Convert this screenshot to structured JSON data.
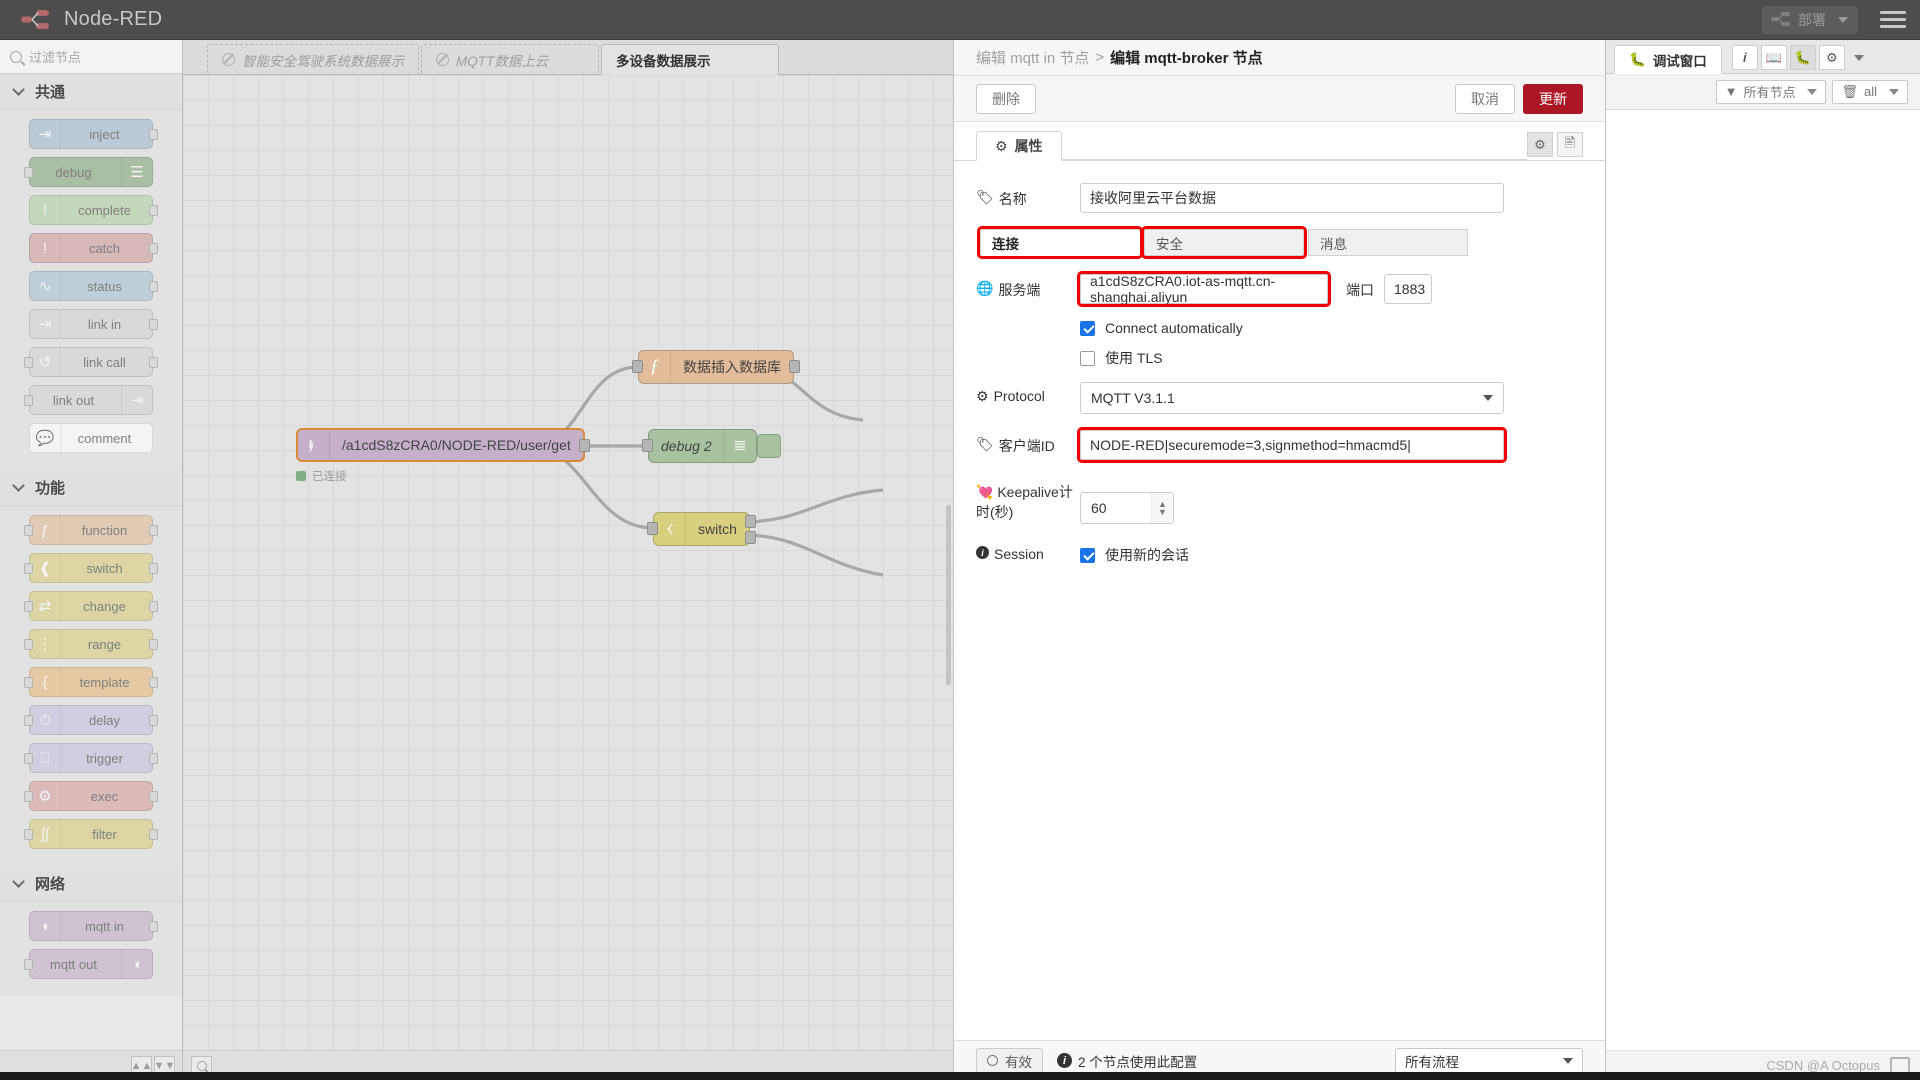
{
  "header": {
    "brand": "Node-RED",
    "logo_icon": "node-red-logo-icon",
    "deploy_label": "部署",
    "deploy_icon": "deploy-icon",
    "menu_icon": "hamburger-menu-icon"
  },
  "palette": {
    "search_placeholder": "过滤节点",
    "search_icon": "search-icon",
    "collapse_icon": "collapse-all-icon",
    "expand_icon": "expand-all-icon",
    "categories": [
      {
        "label": "共通",
        "nodes": [
          {
            "label": "inject",
            "icon": "inject-icon",
            "color": "#a6bbcf",
            "icon_side": "left",
            "ports": "out"
          },
          {
            "label": "debug",
            "icon": "debug-icon",
            "color": "#87a980",
            "icon_side": "right",
            "ports": "in"
          },
          {
            "label": "complete",
            "icon": "complete-icon",
            "color": "#b5d3a5",
            "icon_side": "left",
            "ports": "out"
          },
          {
            "label": "catch",
            "icon": "catch-icon",
            "color": "#d1a0a0",
            "icon_side": "left",
            "ports": "out"
          },
          {
            "label": "status",
            "icon": "status-icon",
            "color": "#a9c5d1",
            "icon_side": "left",
            "ports": "out"
          },
          {
            "label": "link in",
            "icon": "link-in-icon",
            "color": "#d4d4d4",
            "icon_side": "left",
            "ports": "out"
          },
          {
            "label": "link call",
            "icon": "link-call-icon",
            "color": "#d4d4d4",
            "icon_side": "left",
            "ports": "both"
          },
          {
            "label": "link out",
            "icon": "link-out-icon",
            "color": "#d4d4d4",
            "icon_side": "right",
            "ports": "in"
          },
          {
            "label": "comment",
            "icon": "comment-icon",
            "color": "#ffffff",
            "icon_side": "left",
            "ports": "none"
          }
        ]
      },
      {
        "label": "功能",
        "nodes": [
          {
            "label": "function",
            "icon": "function-icon",
            "color": "#e3bd9a",
            "icon_side": "left",
            "ports": "both"
          },
          {
            "label": "switch",
            "icon": "switch-icon",
            "color": "#d8d07f",
            "icon_side": "left",
            "ports": "both"
          },
          {
            "label": "change",
            "icon": "change-icon",
            "color": "#d8d07f",
            "icon_side": "left",
            "ports": "both"
          },
          {
            "label": "range",
            "icon": "range-icon",
            "color": "#d8d07f",
            "icon_side": "left",
            "ports": "both"
          },
          {
            "label": "template",
            "icon": "template-icon",
            "color": "#e8bb7d",
            "icon_side": "left",
            "ports": "both"
          },
          {
            "label": "delay",
            "icon": "delay-icon",
            "color": "#c6c3de",
            "icon_side": "left",
            "ports": "both"
          },
          {
            "label": "trigger",
            "icon": "trigger-icon",
            "color": "#c6c3de",
            "icon_side": "left",
            "ports": "both"
          },
          {
            "label": "exec",
            "icon": "exec-icon",
            "color": "#d7a3a0",
            "icon_side": "left",
            "ports": "both"
          },
          {
            "label": "filter",
            "icon": "filter-icon",
            "color": "#d8d07f",
            "icon_side": "left",
            "ports": "both"
          }
        ]
      },
      {
        "label": "网络",
        "nodes": [
          {
            "label": "mqtt in",
            "icon": "mqtt-icon",
            "color": "#c4b0c8",
            "icon_side": "left",
            "ports": "out"
          },
          {
            "label": "mqtt out",
            "icon": "mqtt-icon",
            "color": "#c4b0c8",
            "icon_side": "right",
            "ports": "in"
          }
        ]
      }
    ]
  },
  "workspace": {
    "tabs": [
      {
        "label": "智能安全驾驶系统数据展示",
        "disabled": true,
        "active": false,
        "icon": "disabled-flow-icon"
      },
      {
        "label": "MQTT数据上云",
        "disabled": true,
        "active": false,
        "icon": "disabled-flow-icon"
      },
      {
        "label": "多设备数据展示",
        "disabled": false,
        "active": true,
        "icon": ""
      }
    ],
    "nodes": [
      {
        "id": "mqtt-in",
        "label": "/a1cdS8zCRA0/NODE-RED/user/get",
        "icon": "mqtt-icon",
        "color": "#c4b0c8",
        "status": "已连接",
        "status_color": "#7fae83",
        "selected": true
      },
      {
        "id": "function-db",
        "label": "数据插入数据库",
        "icon": "function-icon",
        "color": "#e3bd9a"
      },
      {
        "id": "debug-2",
        "label": "debug 2",
        "icon": "debug-icon",
        "color": "#a8c2a0"
      },
      {
        "id": "switch-1",
        "label": "switch",
        "icon": "switch-icon",
        "color": "#d8d07f"
      }
    ],
    "search_icon": "search-icon",
    "collapse_icon": "collapse-icon",
    "expand_icon": "expand-icon"
  },
  "editor": {
    "breadcrumb_prev": "编辑 mqtt in 节点",
    "breadcrumb_sep": ">",
    "breadcrumb_current": "编辑 mqtt-broker 节点",
    "delete_label": "删除",
    "cancel_label": "取消",
    "update_label": "更新",
    "update_color": "#ad1625",
    "tab_label": "属性",
    "tab_icon": "gear-icon",
    "tab_btn_gear_icon": "gear-icon",
    "tab_btn_doc_icon": "description-icon",
    "name_label": "名称",
    "name_icon": "tag-icon",
    "name_value": "接收阿里云平台数据",
    "subtabs": [
      {
        "label": "连接",
        "active": true,
        "highlighted": true
      },
      {
        "label": "安全",
        "active": false,
        "highlighted": true
      },
      {
        "label": "消息",
        "active": false,
        "highlighted": false
      }
    ],
    "server_label": "服务端",
    "server_icon": "globe-icon",
    "server_value": "a1cdS8zCRA0.iot-as-mqtt.cn-shanghai.aliyun",
    "port_label": "端口",
    "port_value": "1883",
    "connect_auto_label": "Connect automatically",
    "connect_auto_checked": true,
    "tls_label": "使用 TLS",
    "tls_checked": false,
    "protocol_label": "Protocol",
    "protocol_icon": "gear-icon",
    "protocol_value": "MQTT V3.1.1",
    "clientid_label": "客户端ID",
    "clientid_icon": "tag-icon",
    "clientid_value": "NODE-RED|securemode=3,signmethod=hmacmd5|",
    "keepalive_label_line1": "Keepalive计",
    "keepalive_label_line2": "时(秒)",
    "keepalive_icon": "heartbeat-icon",
    "keepalive_value": "60",
    "session_label": "Session",
    "session_icon": "info-icon",
    "session_checkbox_label": "使用新的会话",
    "session_checked": true,
    "footer": {
      "enable_label": "有效",
      "enable_icon": "circle-icon",
      "usage_text": "2 个节点使用此配置",
      "usage_icon": "info-icon",
      "scope_value": "所有流程"
    },
    "highlight_color": "#f10000"
  },
  "sidebar": {
    "tab_label": "调试窗口",
    "tab_icon": "bug-icon",
    "buttons": [
      {
        "icon": "info-icon",
        "label": "i",
        "active": false
      },
      {
        "icon": "book-icon",
        "label": "",
        "active": false
      },
      {
        "icon": "bug-icon",
        "label": "",
        "active": true
      },
      {
        "icon": "gear-icon",
        "label": "",
        "active": false
      }
    ],
    "more_icon": "chevron-down-icon",
    "filter_label": "所有节点",
    "filter_icon": "filter-icon",
    "clear_label": "all",
    "clear_icon": "trash-icon",
    "messages": []
  },
  "watermark": {
    "text": "CSDN @A  Octopus",
    "icon": "monitor-icon"
  }
}
